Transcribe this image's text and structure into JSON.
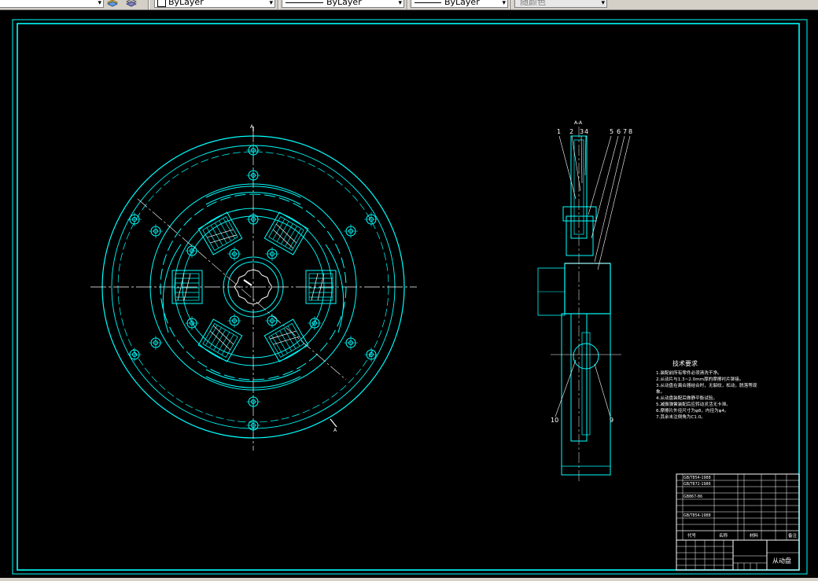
{
  "toolbar": {
    "layer_combo_arrow": "▾",
    "color_combo": {
      "label": "ByLayer",
      "arrow": "▾"
    },
    "linetype_combo": {
      "label": "ByLayer",
      "arrow": "▾"
    },
    "lineweight_combo": {
      "label": "ByLayer",
      "arrow": "▾"
    },
    "plotstyle_combo": {
      "label": "随颜色",
      "arrow": "▾"
    }
  },
  "drawing": {
    "colors": {
      "background": "#000000",
      "line": "#00ffff",
      "text": "#ffffff"
    },
    "front_view": {
      "section_label_top": "A",
      "section_label_bottom": "A"
    },
    "side_view": {
      "section_title": "A-A",
      "callouts_top": [
        "1",
        "2",
        "3",
        "4",
        "5",
        "6",
        "7",
        "8"
      ],
      "callouts_bottom": [
        "10",
        "9"
      ]
    },
    "technical_requirements": {
      "title": "技术要求",
      "lines": [
        "1.装配前所有零件必须清洗干净。",
        "2.从动片与1.3~2.0mm厚的摩擦衬片铆接。",
        "3.从动盘在离合器结合时，无裂纹，松动，脱落等现",
        "象。",
        "4.从动盘装配后做静平衡试验。",
        "5.减振弹簧装配后应转动灵活无卡滞。",
        "6.摩擦片外径尺寸为φ8，内径为φ4。",
        "7.其余未注倒角为C1.0。"
      ]
    },
    "title_block": {
      "part_name": "从动盘",
      "parts_list_codes": [
        "GB/T854-1988",
        "GB/T872-1986",
        "",
        "GB867-86",
        "",
        "",
        "GB/T854-1988",
        ""
      ],
      "header_labels": [
        "代号",
        "名称",
        "材料",
        "备注"
      ]
    }
  }
}
